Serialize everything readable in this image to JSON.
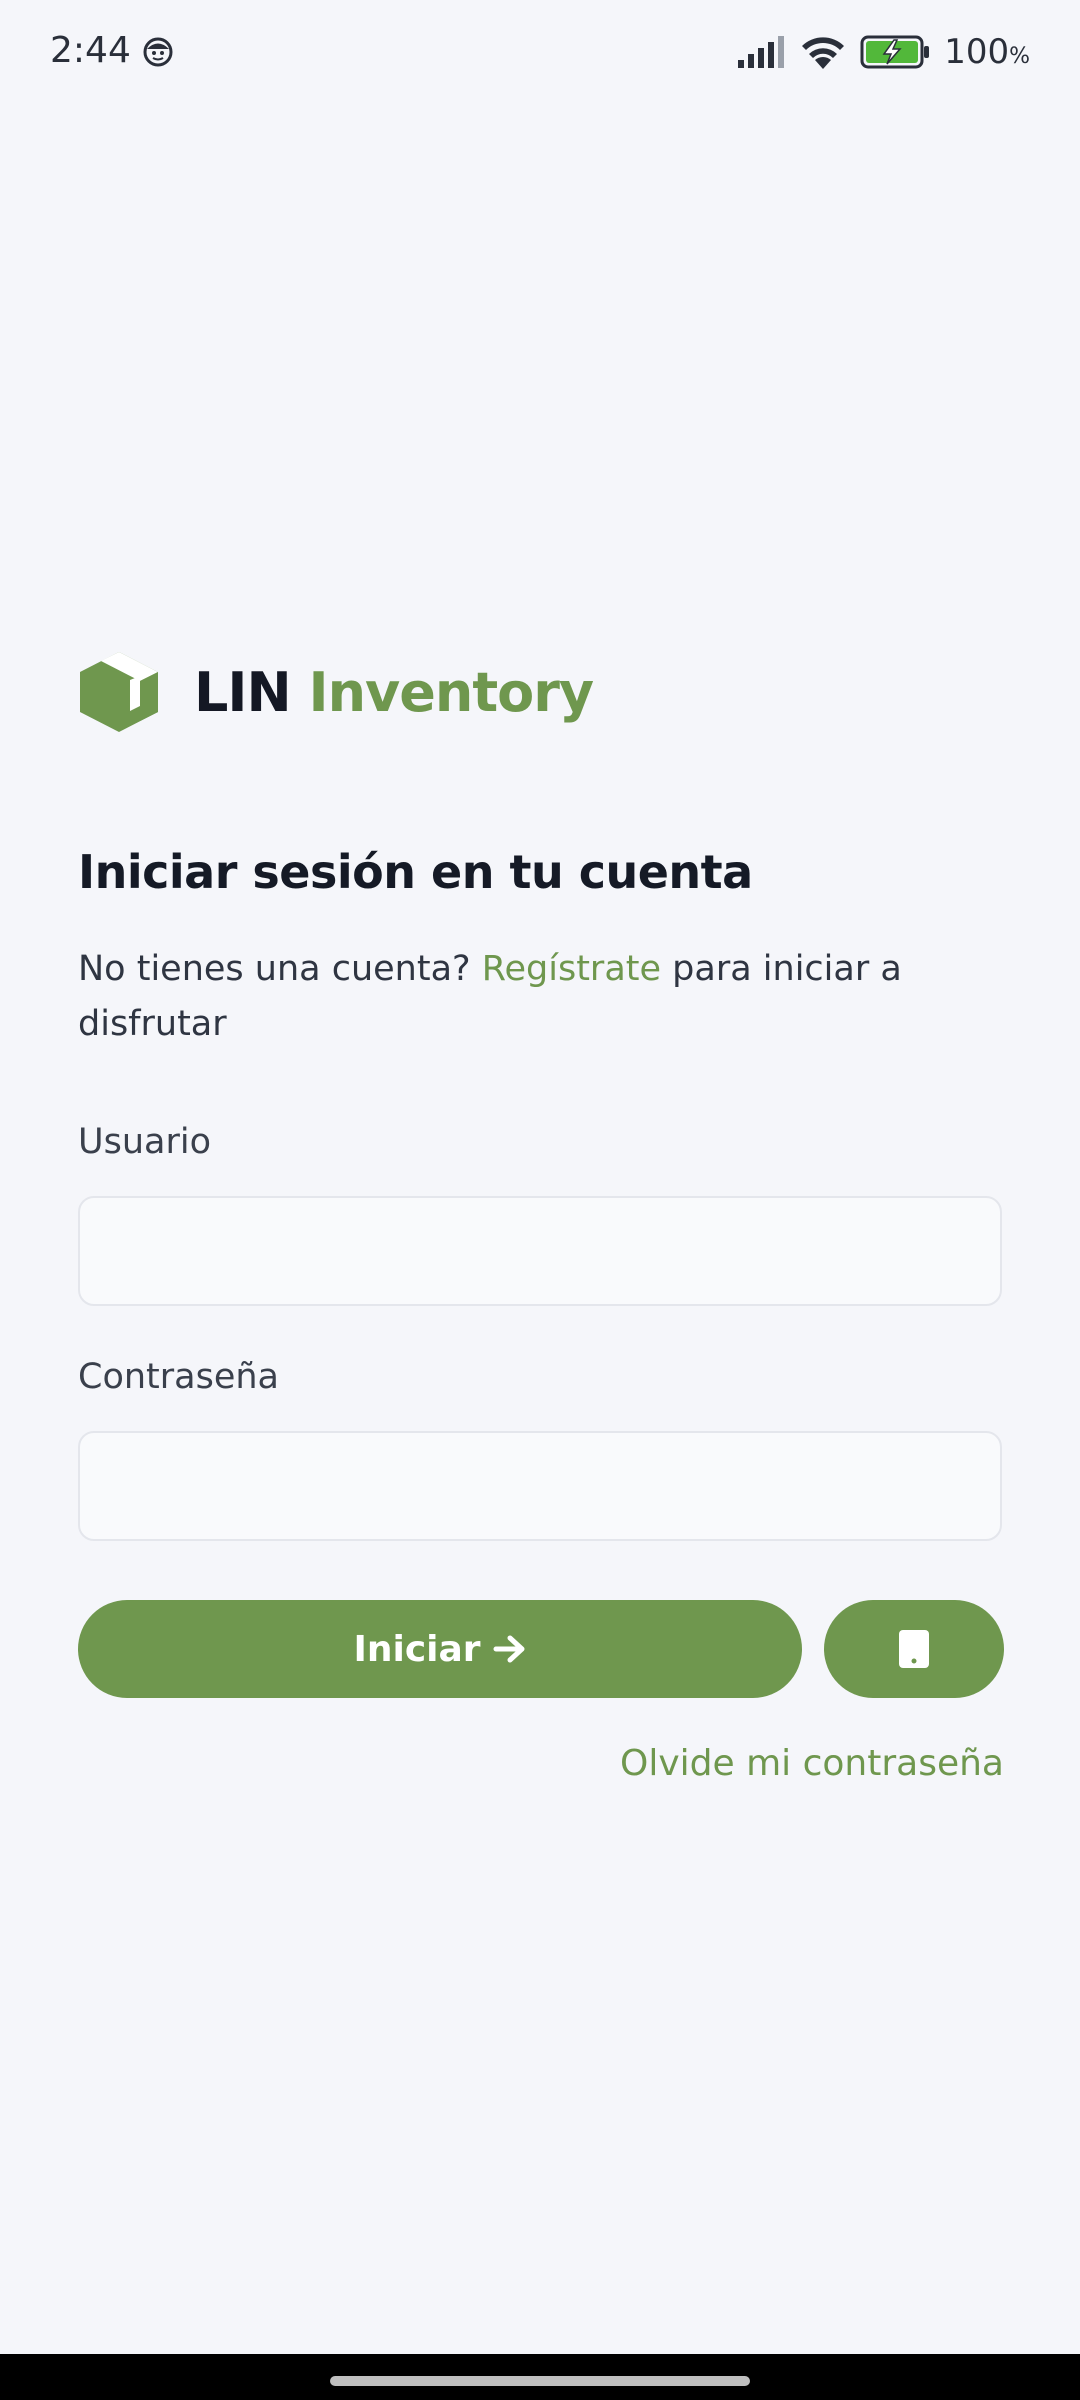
{
  "status_bar": {
    "time": "2:44",
    "battery_percent": "100",
    "battery_unit": "%",
    "icons": [
      "face-emoji-icon",
      "signal-icon",
      "wifi-icon",
      "battery-charging-icon"
    ]
  },
  "brand": {
    "name_part1": "LIN",
    "name_part2": "Inventory",
    "logo_icon": "box-icon",
    "color": "#6f974e"
  },
  "login": {
    "title": "Iniciar sesión en tu cuenta",
    "subtitle_prefix": "No tienes una cuenta?",
    "register_link": "Regístrate",
    "subtitle_suffix": "para iniciar a disfrutar",
    "username_label": "Usuario",
    "username_value": "",
    "password_label": "Contraseña",
    "password_value": "",
    "submit_label": "Iniciar",
    "submit_icon": "arrow-right-icon",
    "device_button_icon": "mobile-device-icon",
    "forgot_password": "Olvide mi contraseña"
  }
}
